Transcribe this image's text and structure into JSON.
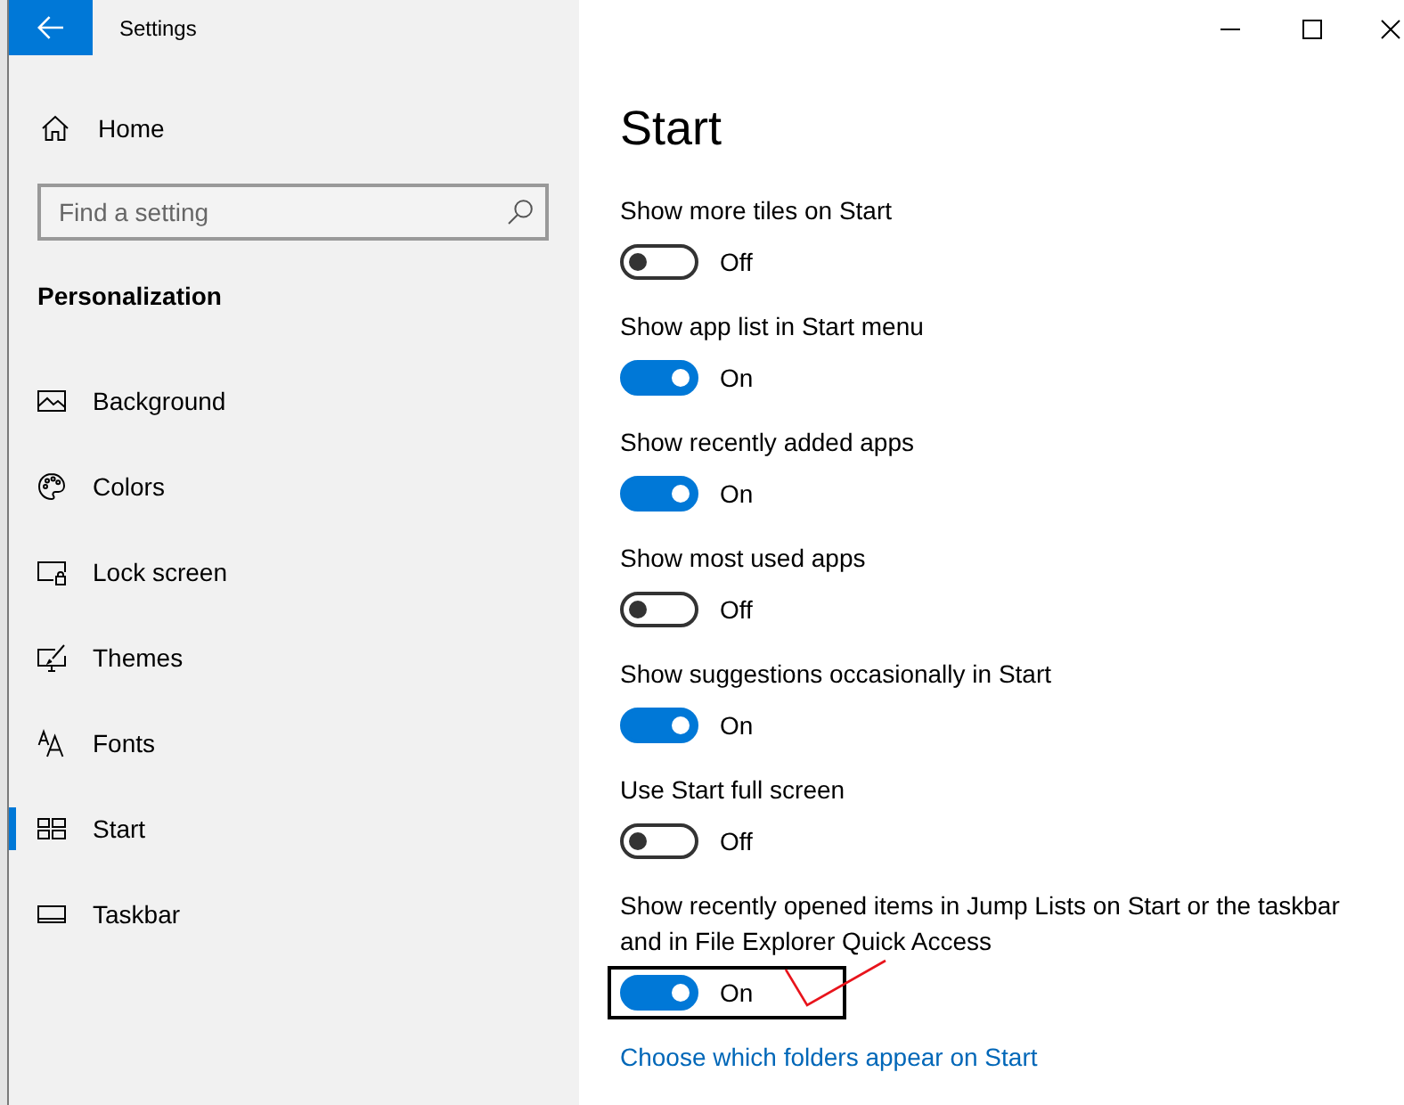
{
  "window": {
    "title": "Settings"
  },
  "sidebar": {
    "home": "Home",
    "search": {
      "placeholder": "Find a setting"
    },
    "section": "Personalization",
    "items": [
      {
        "kind": "background",
        "label": "Background",
        "selected": false
      },
      {
        "kind": "colors",
        "label": "Colors",
        "selected": false
      },
      {
        "kind": "lock",
        "label": "Lock screen",
        "selected": false
      },
      {
        "kind": "themes",
        "label": "Themes",
        "selected": false
      },
      {
        "kind": "fonts",
        "label": "Fonts",
        "selected": false
      },
      {
        "kind": "start",
        "label": "Start",
        "selected": true
      },
      {
        "kind": "taskbar",
        "label": "Taskbar",
        "selected": false
      }
    ]
  },
  "page": {
    "title": "Start",
    "settings": [
      {
        "label": "Show more tiles on Start",
        "on": false,
        "state_text": "Off",
        "highlighted": false
      },
      {
        "label": "Show app list in Start menu",
        "on": true,
        "state_text": "On",
        "highlighted": false
      },
      {
        "label": "Show recently added apps",
        "on": true,
        "state_text": "On",
        "highlighted": false
      },
      {
        "label": "Show most used apps",
        "on": false,
        "state_text": "Off",
        "highlighted": false
      },
      {
        "label": "Show suggestions occasionally in Start",
        "on": true,
        "state_text": "On",
        "highlighted": false
      },
      {
        "label": "Use Start full screen",
        "on": false,
        "state_text": "Off",
        "highlighted": false
      },
      {
        "label": "Show recently opened items in Jump Lists on Start or the taskbar and in File Explorer Quick Access",
        "on": true,
        "state_text": "On",
        "highlighted": true
      }
    ],
    "link": "Choose which folders appear on Start"
  }
}
